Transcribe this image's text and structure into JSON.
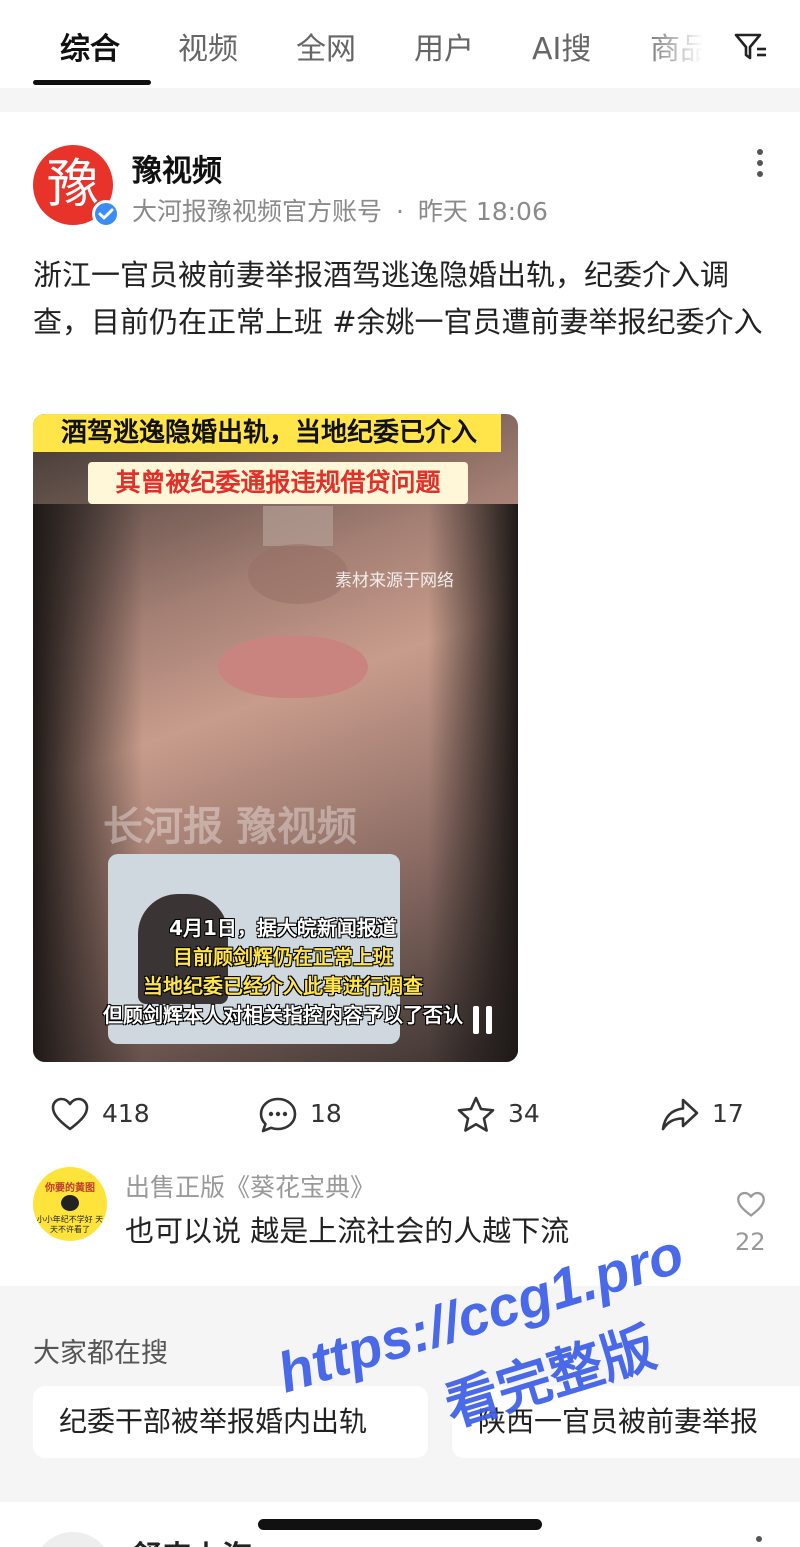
{
  "tabs": [
    {
      "label": "综合",
      "active": true
    },
    {
      "label": "视频",
      "active": false
    },
    {
      "label": "全网",
      "active": false
    },
    {
      "label": "用户",
      "active": false
    },
    {
      "label": "AI搜",
      "active": false
    },
    {
      "label": "商品",
      "active": false
    }
  ],
  "filter_icon": "filter-icon",
  "post": {
    "author": "豫视频",
    "avatar_glyph": "豫",
    "account_desc": "大河报豫视频官方账号",
    "time": "昨天 18:06",
    "separator": "·",
    "text": "浙江一官员被前妻举报酒驾逃逸隐婚出轨，纪委介入调查，目前仍在正常上班 #余姚一官员遭前妻举报纪委介入",
    "video": {
      "banner_top": "酒驾逃逸隐婚出轨，当地纪委已介入",
      "banner_second": "其曾被纪委通报违规借贷问题",
      "source_note": "素材来源于网络",
      "watermark": "长河报 豫视频",
      "subtitles": [
        {
          "text": "4月1日，据大皖新闻报道",
          "color": "white"
        },
        {
          "text": "目前顾剑辉仍在正常上班",
          "color": "yellow"
        },
        {
          "text": "当地纪委已经介入此事进行调查",
          "color": "yellow"
        },
        {
          "text": "但顾剑辉本人对相关指控内容予以了否认",
          "color": "white"
        }
      ]
    },
    "stats": {
      "likes": "418",
      "comments": "18",
      "favorites": "34",
      "shares": "17"
    },
    "top_comment": {
      "avatar_top": "你要的黄图",
      "avatar_bottom": "小小年纪不学好 天天不许看了",
      "user": "出售正版《葵花宝典》",
      "text": "也可以说 越是上流社会的人越下流",
      "likes": "22"
    }
  },
  "trending": {
    "title": "大家都在搜",
    "chips": [
      "纪委干部被举报婚内出轨",
      "陕西一官员被前妻举报"
    ]
  },
  "next_card": {
    "name": "舒来上海"
  },
  "overlay": {
    "url": "https://ccg1.pro",
    "text": "看完整版"
  },
  "colors": {
    "accent_red": "#e8332a",
    "verified_blue": "#3b8cf5",
    "overlay_blue": "#3b5ee8",
    "banner_yellow": "#ffe44a"
  }
}
